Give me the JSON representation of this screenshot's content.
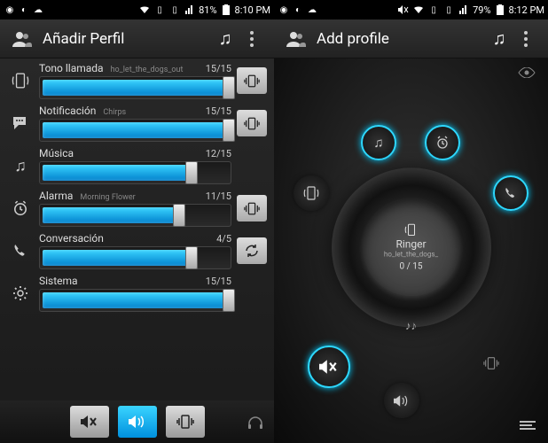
{
  "left": {
    "status": {
      "battery": "81%",
      "time": "8:10 PM"
    },
    "title": "Añadir Perfil",
    "rows": [
      {
        "label": "Tono llamada",
        "tone": "ho_let_the_dogs_out",
        "value": "15/15",
        "fill": 100,
        "icon": "ringer",
        "action": "vibrate"
      },
      {
        "label": "Notificación",
        "tone": "Chirps",
        "value": "15/15",
        "fill": 100,
        "icon": "notification",
        "action": "vibrate"
      },
      {
        "label": "Música",
        "tone": "",
        "value": "12/15",
        "fill": 80,
        "icon": "music",
        "action": ""
      },
      {
        "label": "Alarma",
        "tone": "Morning Flower",
        "value": "11/15",
        "fill": 73,
        "icon": "alarm",
        "action": "vibrate"
      },
      {
        "label": "Conversación",
        "tone": "",
        "value": "4/5",
        "fill": 80,
        "icon": "phone",
        "action": "refresh"
      },
      {
        "label": "Sistema",
        "tone": "",
        "value": "15/15",
        "fill": 100,
        "icon": "gear",
        "action": ""
      }
    ]
  },
  "right": {
    "status": {
      "battery": "79%",
      "time": "8:12 PM"
    },
    "title": "Add profile",
    "dial": {
      "label": "Ringer",
      "tone": "ho_let_the_dogs_",
      "count": "0 / 15"
    }
  }
}
